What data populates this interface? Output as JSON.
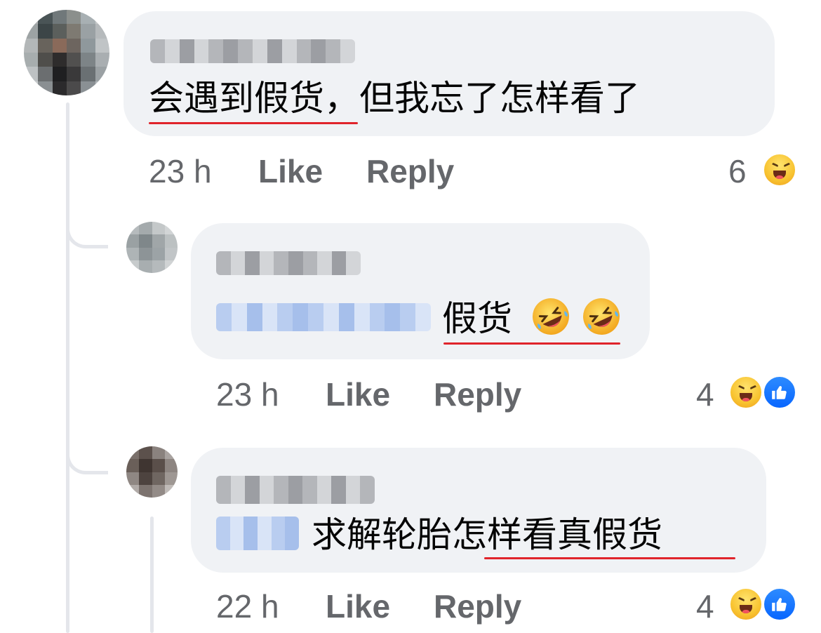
{
  "comments": [
    {
      "text": "会遇到假货，但我忘了怎样看了",
      "time": "23 h",
      "like_label": "Like",
      "reply_label": "Reply",
      "reaction_count": "6",
      "reactions": [
        "haha-icon"
      ]
    },
    {
      "mention": "",
      "text": "假货",
      "emojis": "🤣🤣",
      "time": "23 h",
      "like_label": "Like",
      "reply_label": "Reply",
      "reaction_count": "4",
      "reactions": [
        "haha-icon",
        "like-icon"
      ]
    },
    {
      "text": "求解轮胎怎样看真假货",
      "time": "22 h",
      "like_label": "Like",
      "reply_label": "Reply",
      "reaction_count": "4",
      "reactions": [
        "haha-icon",
        "like-icon"
      ]
    }
  ],
  "colors": {
    "bubble": "#f0f2f5",
    "meta_text": "#65676b",
    "underline": "#e0242b",
    "thread_line": "#e4e6eb",
    "like_blue": "#0866ff"
  }
}
